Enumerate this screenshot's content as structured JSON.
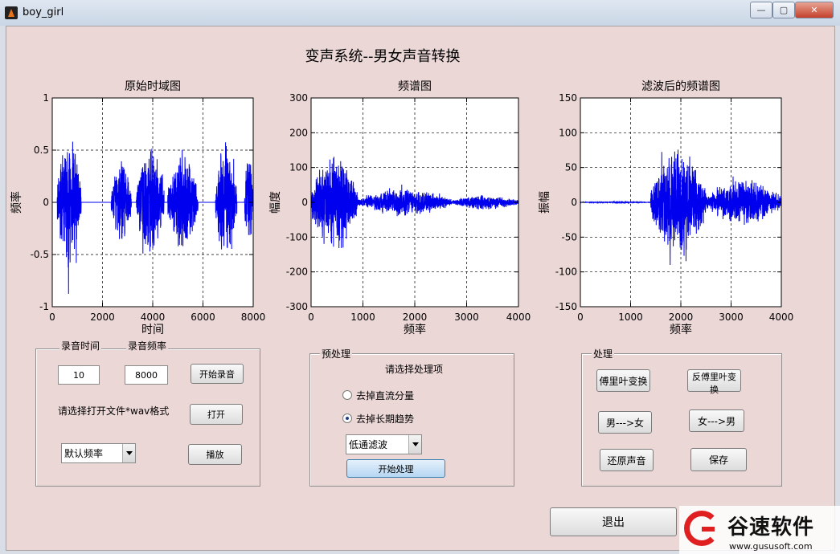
{
  "window": {
    "title": "boy_girl",
    "controls": [
      "—",
      "▢",
      "✕"
    ]
  },
  "main_title": "变声系统--男女声音转换",
  "chart_data": [
    {
      "type": "line",
      "title": "原始时域图",
      "xlabel": "时间",
      "ylabel": "频率",
      "xlim": [
        0,
        8000
      ],
      "ylim": [
        -1,
        1
      ],
      "xticks": [
        0,
        2000,
        4000,
        6000,
        8000
      ],
      "yticks": [
        -1,
        -0.5,
        0,
        0.5,
        1
      ],
      "grid": true,
      "color": "#0000ee",
      "bursts": [
        {
          "x0": 200,
          "x1": 1150,
          "amp": 0.9
        },
        {
          "x0": 2350,
          "x1": 3150,
          "amp": 0.6
        },
        {
          "x0": 3350,
          "x1": 4450,
          "amp": 0.8
        },
        {
          "x0": 4600,
          "x1": 5800,
          "amp": 0.7
        },
        {
          "x0": 6500,
          "x1": 7350,
          "amp": 0.85
        },
        {
          "x0": 7650,
          "x1": 8000,
          "amp": 0.7
        }
      ]
    },
    {
      "type": "line",
      "title": "频谱图",
      "xlabel": "频率",
      "ylabel": "幅度",
      "xlim": [
        0,
        4000
      ],
      "ylim": [
        -300,
        300
      ],
      "xticks": [
        0,
        1000,
        2000,
        3000,
        4000
      ],
      "yticks": [
        -300,
        -200,
        -100,
        0,
        100,
        200,
        300
      ],
      "grid": true,
      "color": "#0000ee",
      "bursts": [
        {
          "x0": 0,
          "x1": 900,
          "amp": 210
        },
        {
          "x0": 900,
          "x1": 2700,
          "amp": 55
        },
        {
          "x0": 2700,
          "x1": 4000,
          "amp": 30
        }
      ]
    },
    {
      "type": "line",
      "title": "滤波后的频谱图",
      "xlabel": "频率",
      "ylabel": "振幅",
      "xlim": [
        0,
        4000
      ],
      "ylim": [
        -150,
        150
      ],
      "xticks": [
        0,
        1000,
        2000,
        3000,
        4000
      ],
      "yticks": [
        -150,
        -100,
        -50,
        0,
        50,
        100,
        150
      ],
      "grid": true,
      "color": "#0000ee",
      "bursts": [
        {
          "x0": 0,
          "x1": 1400,
          "amp": 1
        },
        {
          "x0": 1400,
          "x1": 2500,
          "amp": 110
        },
        {
          "x0": 2500,
          "x1": 4000,
          "amp": 45
        }
      ]
    }
  ],
  "record_panel": {
    "label_time": "录音时间",
    "label_rate": "录音频率",
    "time_value": "10",
    "rate_value": "8000",
    "start_record": "开始录音",
    "open_hint": "请选择打开文件*wav格式",
    "open_button": "打开",
    "freq_select": "默认频率",
    "play_button": "播放"
  },
  "preprocess_panel": {
    "title": "预处理",
    "prompt": "请选择处理项",
    "radio_dc": "去掉直流分量",
    "radio_trend": "去掉长期趋势",
    "filter_select": "低通滤波",
    "start_button": "开始处理"
  },
  "process_panel": {
    "title": "处理",
    "fft_button": "傅里叶变换",
    "ifft_button": "反傅里叶变换",
    "m2f_button": "男--->女",
    "f2m_button": "女--->男",
    "restore_button": "还原声音",
    "save_button": "保存"
  },
  "exit_button": "退出",
  "watermark": {
    "name": "谷速软件",
    "url": "www.gususoft.com"
  }
}
